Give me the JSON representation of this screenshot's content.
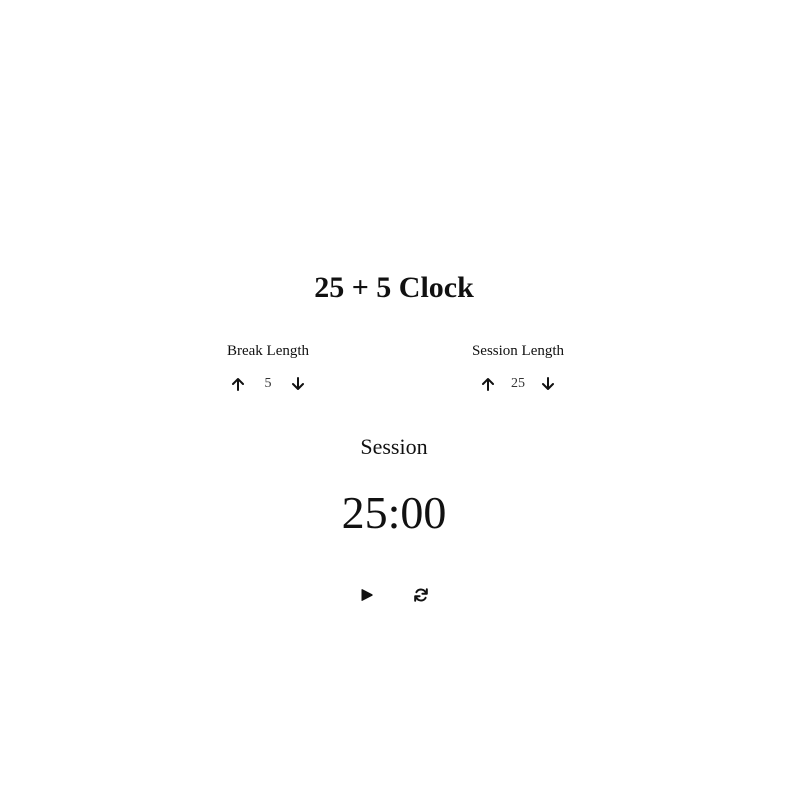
{
  "app": {
    "title": "25 + 5 Clock"
  },
  "break": {
    "label": "Break Length",
    "value": "5",
    "increment_icon": "arrow-up-icon",
    "decrement_icon": "arrow-down-icon"
  },
  "session": {
    "label": "Session Length",
    "value": "25",
    "increment_icon": "arrow-up-icon",
    "decrement_icon": "arrow-down-icon"
  },
  "timer": {
    "label": "Session",
    "time_left": "25:00",
    "play_icon": "play-icon",
    "reset_icon": "refresh-icon"
  }
}
